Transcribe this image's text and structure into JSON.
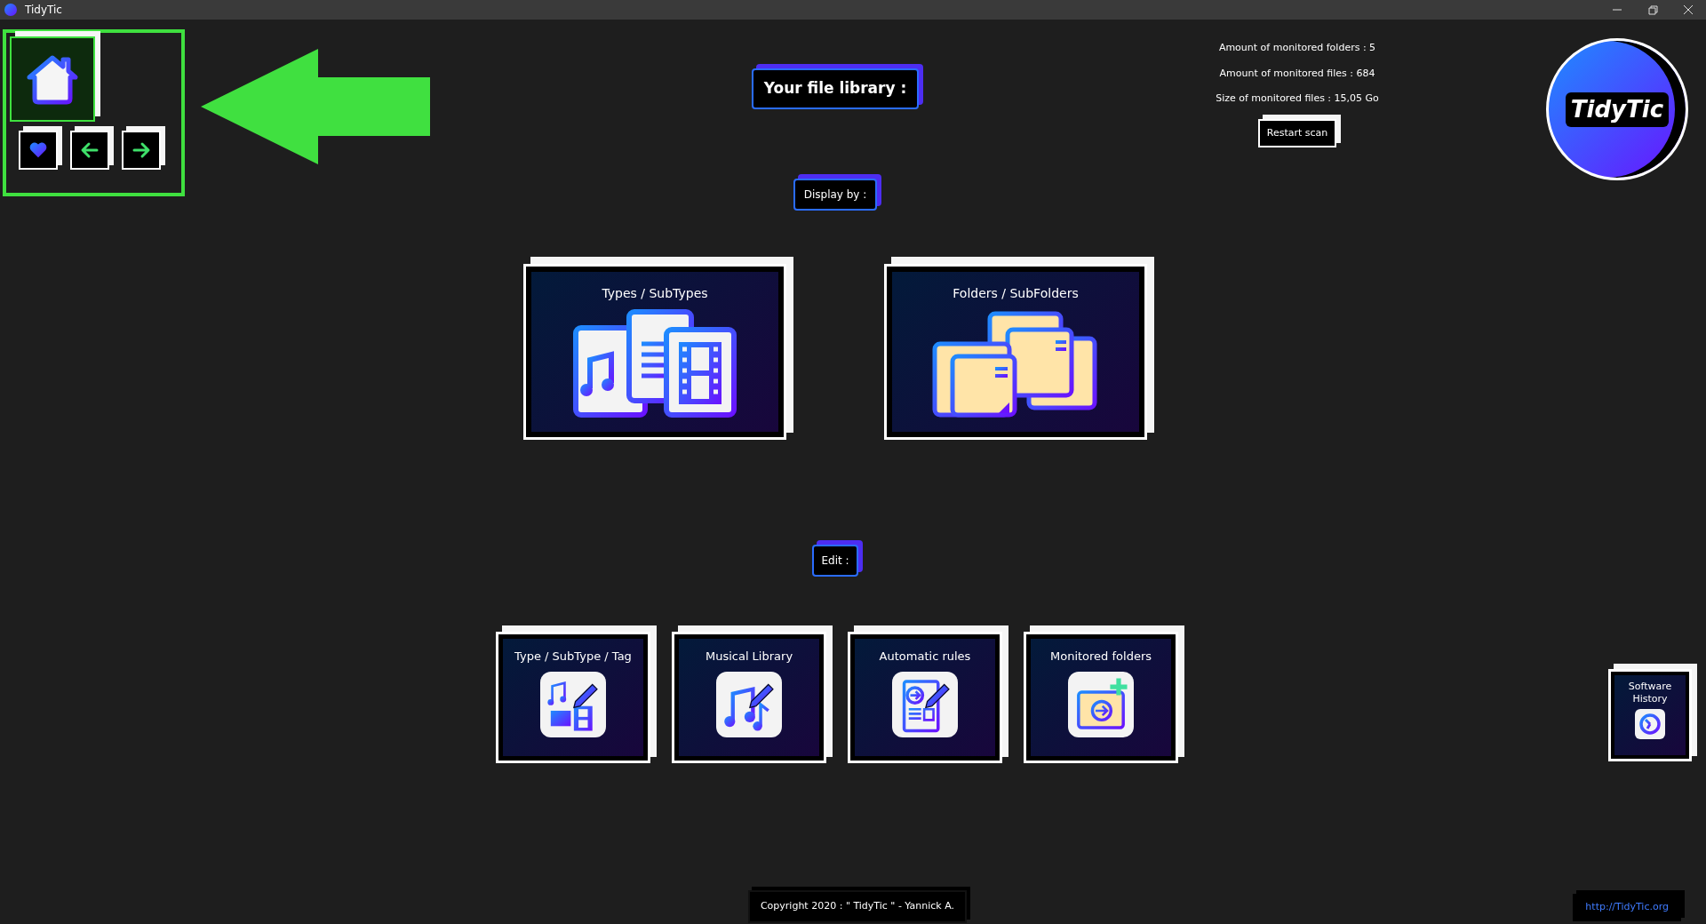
{
  "window": {
    "title": "TidyTic"
  },
  "nav_buttons": [
    {
      "kind": "home",
      "selected": true
    },
    {
      "kind": "favorites",
      "selected": false
    },
    {
      "kind": "back",
      "selected": false
    },
    {
      "kind": "forward",
      "selected": false
    }
  ],
  "stats": [
    "Amount of monitored folders : 5",
    "Amount of monitored files : 684",
    "Size of monitored files : 15,05 Go"
  ],
  "restart_button": "Restart scan",
  "logo_text": "TidyTic",
  "library_heading": "Your file library :",
  "display_heading": "Display by :",
  "display_cards": [
    {
      "kind": "types",
      "label": "Types / SubTypes"
    },
    {
      "kind": "folders",
      "label": "Folders / SubFolders"
    }
  ],
  "edit_heading": "Edit :",
  "edit_cards": [
    {
      "kind": "tags",
      "label": "Type / SubType / Tag"
    },
    {
      "kind": "music",
      "label": "Musical Library"
    },
    {
      "kind": "rules",
      "label": "Automatic rules"
    },
    {
      "kind": "monitored",
      "label": "Monitored folders"
    }
  ],
  "history_button": "Software History",
  "footer": {
    "copyright": "Copyright 2020 : \" TidyTic \" - Yannick A.",
    "link": "http://TidyTic.org"
  }
}
